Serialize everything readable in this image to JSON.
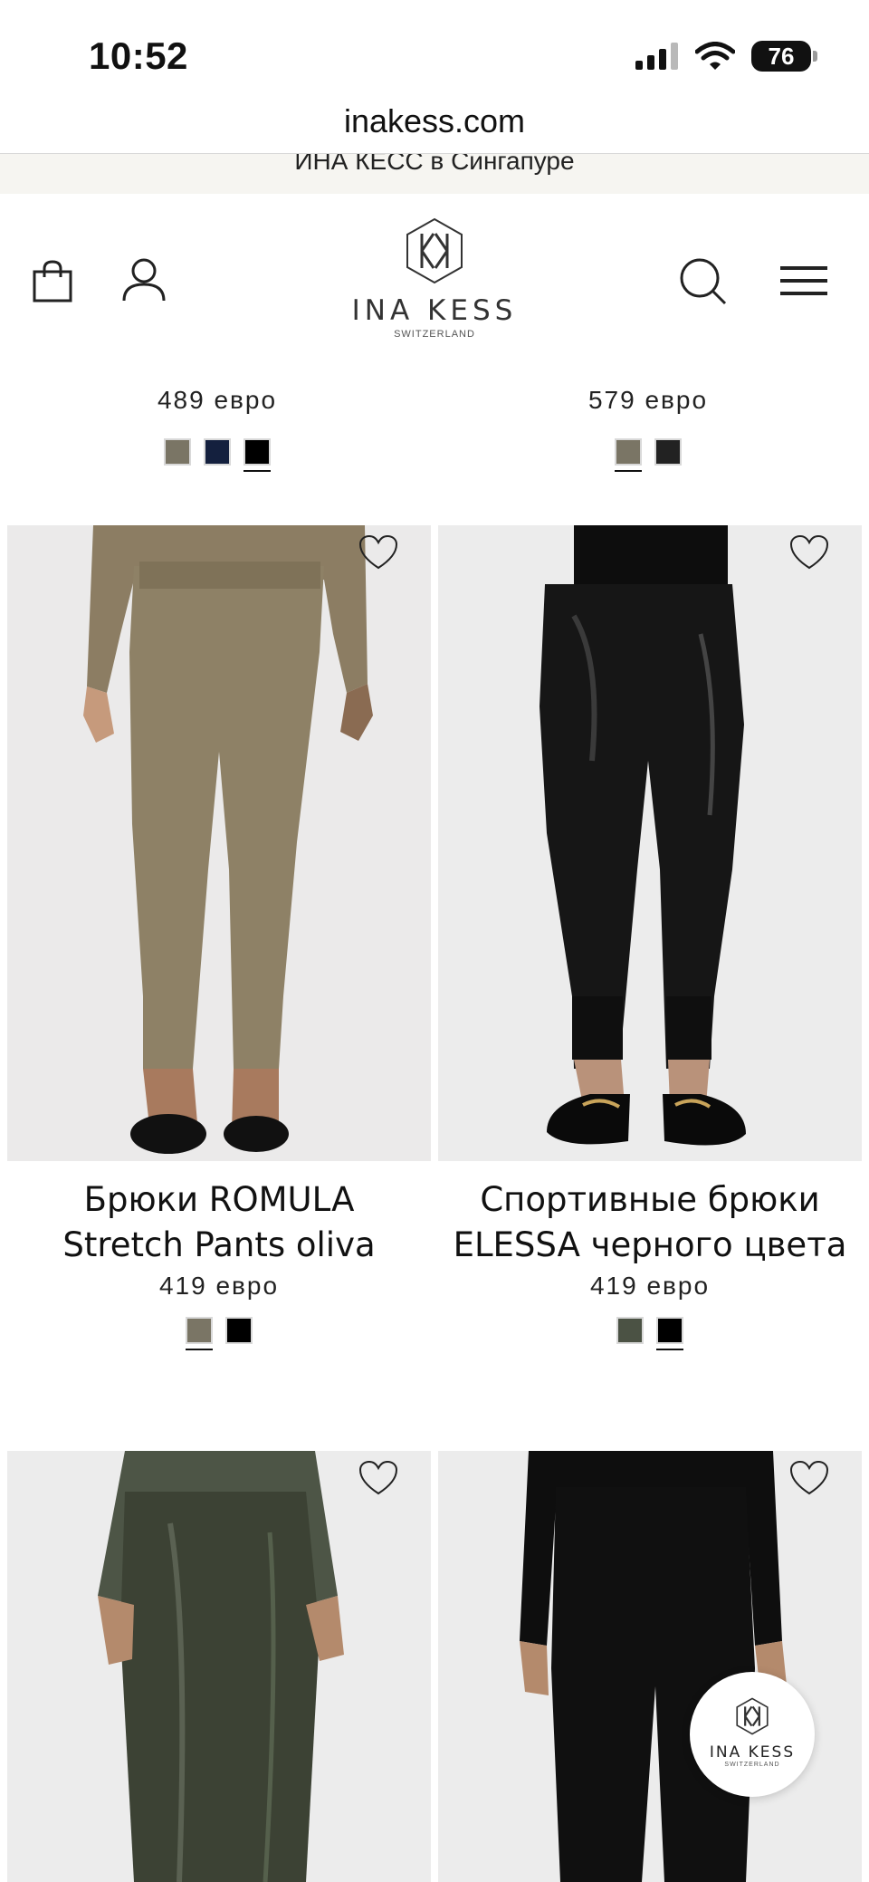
{
  "status_bar": {
    "time": "10:52",
    "battery": "76",
    "icons": [
      "signal-icon",
      "wifi-icon",
      "battery-icon"
    ]
  },
  "browser": {
    "url": "inakess.com"
  },
  "announcement": {
    "text": "ИНА КЕСС в Сингапуре"
  },
  "header": {
    "brand": "INA KESS",
    "brand_sub": "SWITZERLAND",
    "icons": [
      "shopping-bag-icon",
      "account-icon",
      "search-icon",
      "menu-icon"
    ]
  },
  "colors": {
    "accent": "#111111",
    "swatch_border": "#d9d9d9",
    "image_bg": "#ececec"
  },
  "products_partial": [
    {
      "price": "489 евро",
      "swatches": [
        "#7a7565",
        "#14203e",
        "#000000"
      ],
      "selected": 2
    },
    {
      "price": "579 евро",
      "swatches": [
        "#7a7565",
        "#222222"
      ],
      "selected": 0
    }
  ],
  "products": [
    {
      "title": "Брюки ROMULA Stretch Pants oliva",
      "price": "419 евро",
      "swatches": [
        "#7a7565",
        "#000000"
      ],
      "selected": 0
    },
    {
      "title": "Спортивные брюки ELESSA черного цвета",
      "price": "419 евро",
      "swatches": [
        "#4b5244",
        "#000000"
      ],
      "selected": 1
    },
    {
      "title": "",
      "price": "",
      "swatches": []
    },
    {
      "title": "",
      "price": "",
      "swatches": []
    }
  ],
  "floating_badge": {
    "brand": "INA KESS",
    "sub": "SWITZERLAND"
  }
}
